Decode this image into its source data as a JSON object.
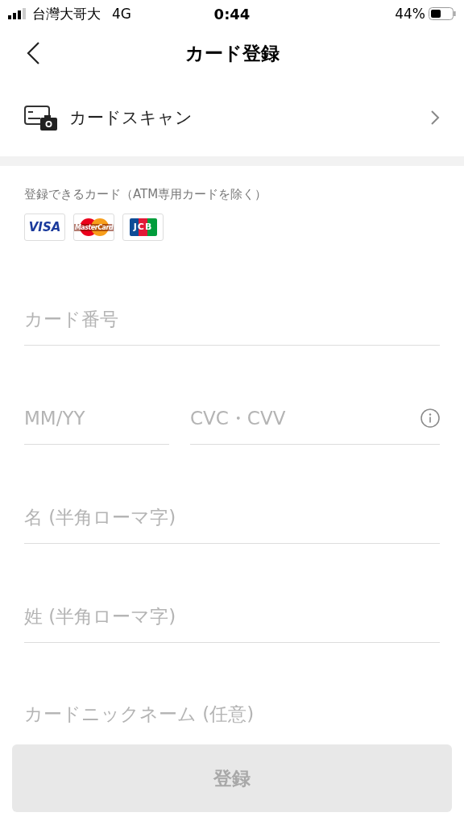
{
  "status_bar": {
    "carrier": "台灣大哥大",
    "network": "4G",
    "time": "0:44",
    "battery": "44%"
  },
  "nav": {
    "title": "カード登録"
  },
  "scan_row": {
    "label": "カードスキャン"
  },
  "accepted": {
    "label": "登録できるカード（ATM専用カードを除く）",
    "brands": [
      {
        "kind": "visa",
        "text": "VISA"
      },
      {
        "kind": "mastercard",
        "text": "MasterCard"
      },
      {
        "kind": "jcb",
        "text": "JCB"
      }
    ]
  },
  "fields": [
    {
      "placeholder": "カード番号"
    },
    {
      "placeholder": "MM/YY"
    },
    {
      "placeholder": "CVC・CVV",
      "info": true
    },
    {
      "placeholder": "名 (半角ローマ字)"
    },
    {
      "placeholder": "姓 (半角ローマ字)"
    },
    {
      "placeholder": "カードニックネーム (任意)"
    }
  ],
  "submit": {
    "label": "登録",
    "disabled": true
  }
}
